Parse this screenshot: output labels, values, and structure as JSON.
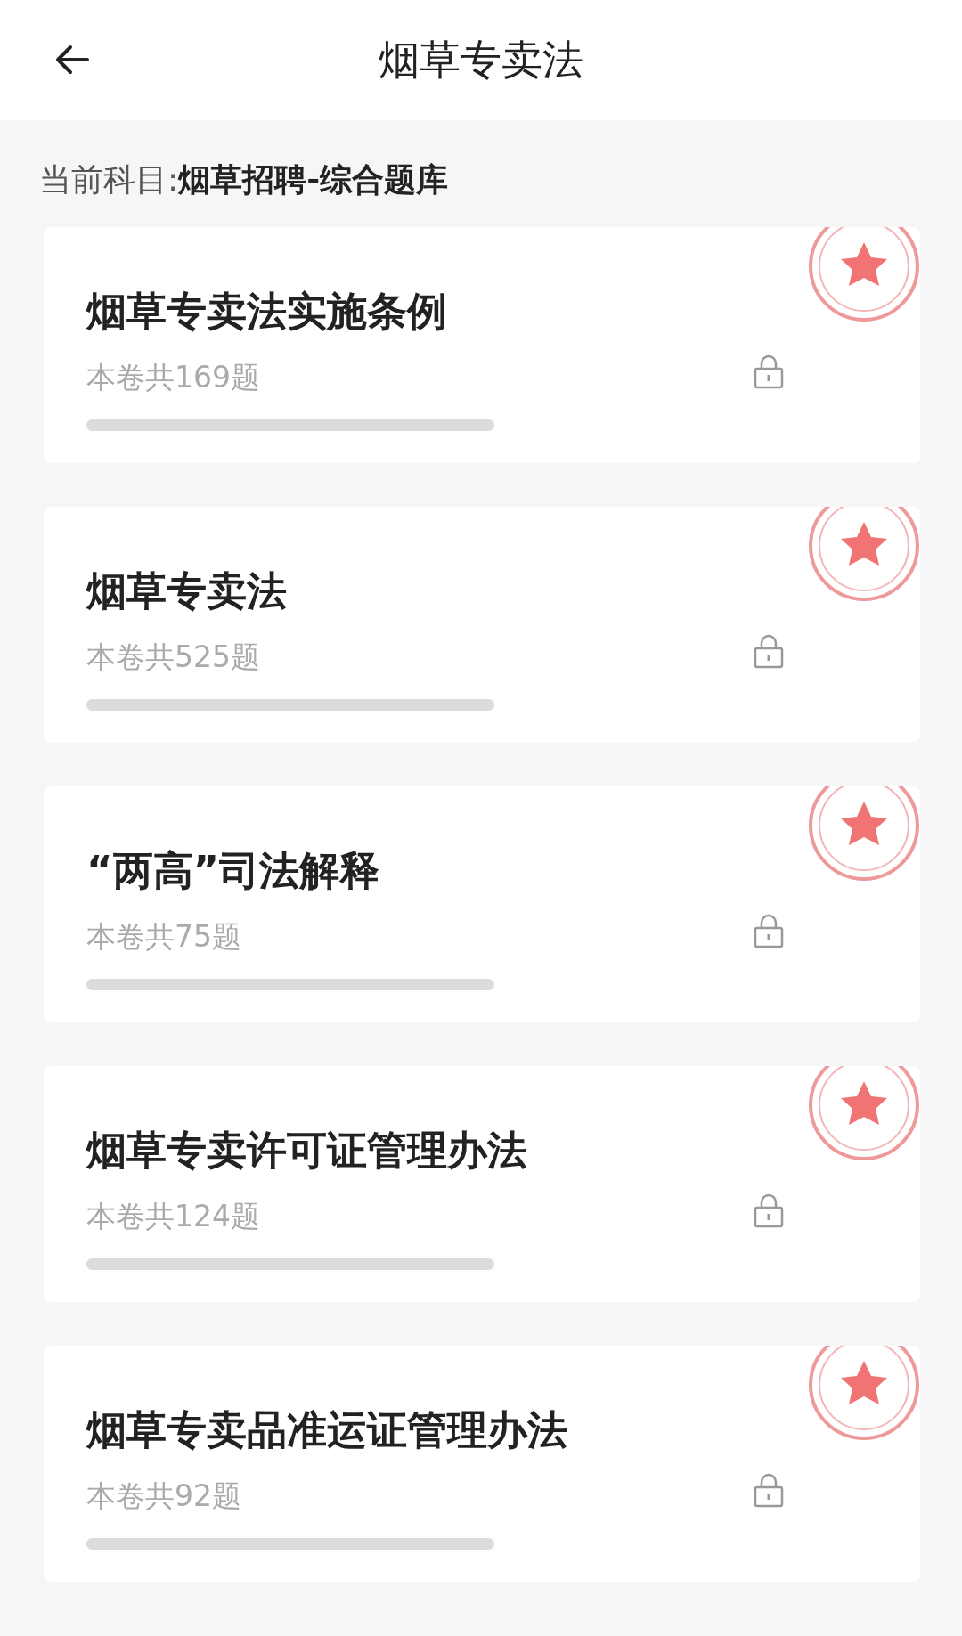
{
  "header": {
    "title": "烟草专卖法"
  },
  "subject": "当前科目:**烟草招聘-综合题库**",
  "papers": [
    {
      "title": "烟草专卖法实施条例",
      "count": "本卷共169题",
      "level": 0,
      "locked": true
    },
    {
      "title": "烟草专卖法",
      "count": "本卷共525题",
      "level": 0,
      "locked": true
    },
    {
      "title": "“两高”司法解释",
      "count": "本卷共75题",
      "level": 0,
      "locked": true
    },
    {
      "title": "烟草专卖许可证管理办法",
      "count": "本卷共124题",
      "level": 0,
      "locked": true
    },
    {
      "title": "烟草专卖品准运证管理办法",
      "count": "本卷共92题",
      "level": 0,
      "locked": true
    }
  ]
}
